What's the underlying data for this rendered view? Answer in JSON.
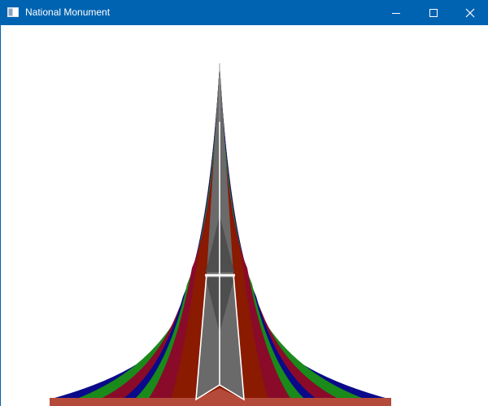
{
  "window": {
    "title": "National Monument",
    "titlebar_color": "#0063b1",
    "icons": {
      "app": "window-app-icon",
      "minimize": "minimize-icon",
      "maximize": "maximize-icon",
      "close": "close-icon"
    }
  },
  "scene": {
    "colors": {
      "base": "#b34a3a",
      "layer_navy": "#0a0a8a",
      "layer_green": "#1a8a1a",
      "layer_crimson": "#8a0a2a",
      "layer_rust": "#8a1a00",
      "spire": "#6a6a6a",
      "spire_shade": "#4e4e4e",
      "outline": "#ffffff"
    }
  }
}
